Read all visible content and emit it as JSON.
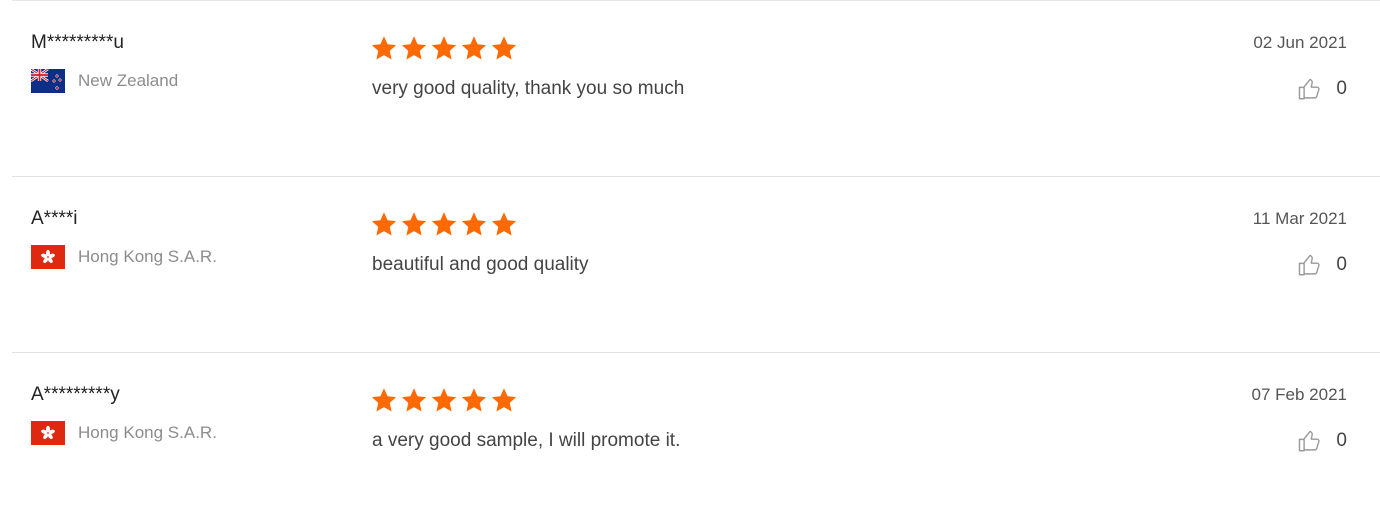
{
  "colors": {
    "star": "#fe6a00",
    "divider": "#e2e2e2",
    "country_text": "#8c8c8c"
  },
  "reviews": [
    {
      "username": "M*********u",
      "country": "New Zealand",
      "flag_icon": "new-zealand-flag-icon",
      "rating": 5,
      "comment": "very good quality, thank you so much",
      "date": "02 Jun 2021",
      "likes": "0"
    },
    {
      "username": "A****i",
      "country": "Hong Kong S.A.R.",
      "flag_icon": "hong-kong-flag-icon",
      "rating": 5,
      "comment": "beautiful and good quality",
      "date": "11 Mar 2021",
      "likes": "0"
    },
    {
      "username": "A*********y",
      "country": "Hong Kong S.A.R.",
      "flag_icon": "hong-kong-flag-icon",
      "rating": 5,
      "comment": "a very good sample, I will promote it.",
      "date": "07 Feb 2021",
      "likes": "0"
    }
  ]
}
